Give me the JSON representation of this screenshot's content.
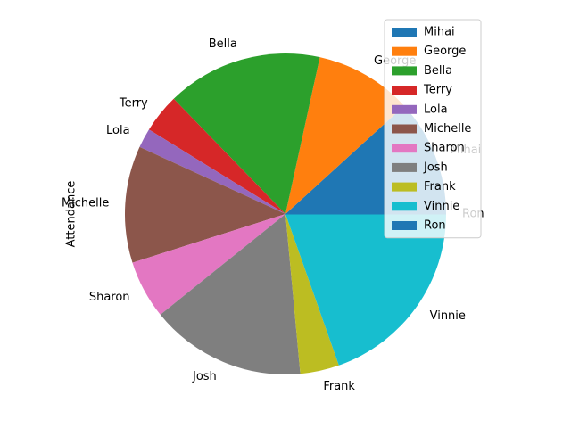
{
  "chart_data": {
    "type": "pie",
    "ylabel": "Attendance",
    "labels": [
      "Mihai",
      "George",
      "Bella",
      "Terry",
      "Lola",
      "Michelle",
      "Sharon",
      "Josh",
      "Frank",
      "Vinnie",
      "Ron"
    ],
    "values": [
      6,
      5,
      8,
      2,
      1,
      6,
      3,
      8,
      2,
      10,
      0
    ],
    "colors": [
      "#1f77b4",
      "#ff7f0e",
      "#2ca02c",
      "#d62728",
      "#9467bd",
      "#8c564b",
      "#e377c2",
      "#7f7f7f",
      "#bcbd22",
      "#17becf",
      "#1f77b4"
    ],
    "legend": {
      "placement": "upper right"
    }
  }
}
